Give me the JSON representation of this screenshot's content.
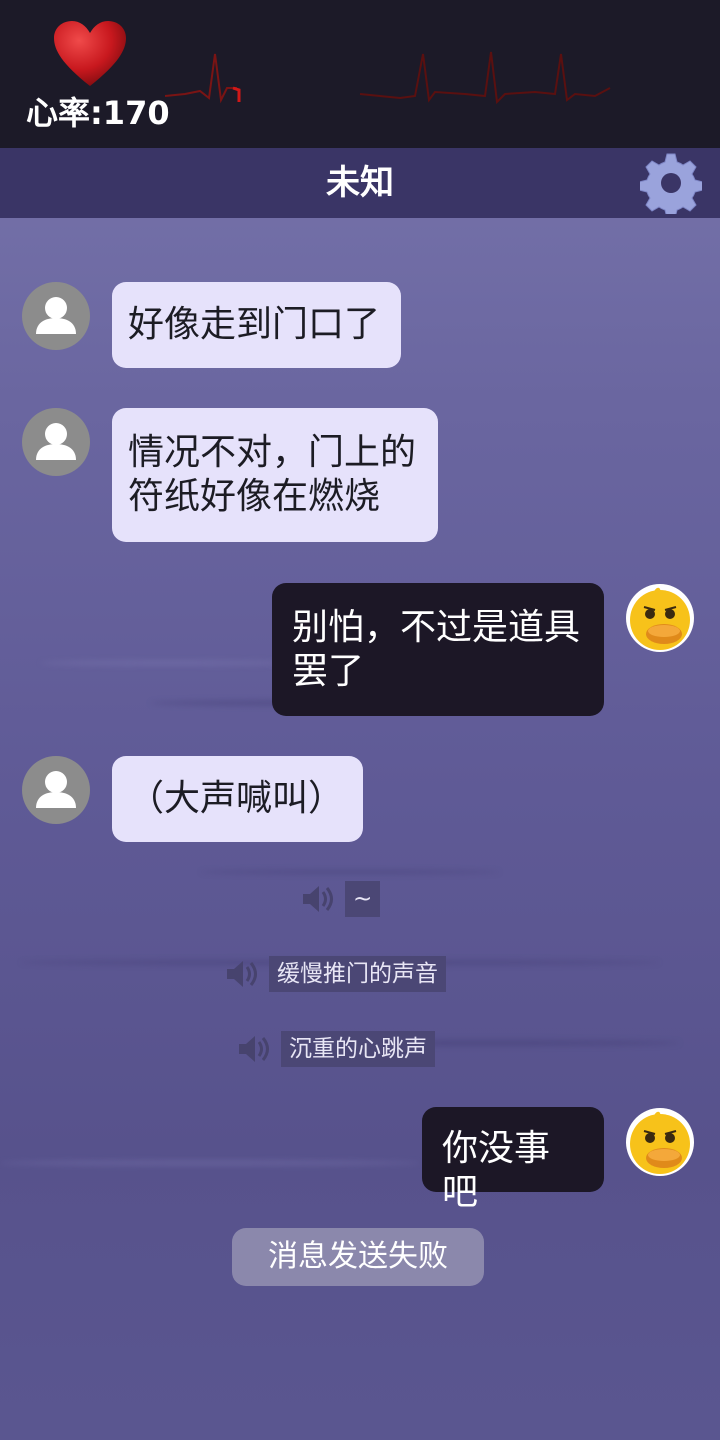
{
  "status": {
    "heart_rate_text": "心率:170"
  },
  "header": {
    "title": "未知"
  },
  "icons": {
    "heart": "heart-icon",
    "settings": "gear-icon",
    "speaker": "speaker-icon",
    "avatar_other": "user-avatar-icon",
    "avatar_me": "duck-avatar-icon"
  },
  "colors": {
    "heart": "#c8181e",
    "ecg_line": "#7a1414",
    "bubble_other": "#e6e2fb",
    "bubble_me": "#1c1726",
    "title_bar": "#3a3566"
  },
  "messages": [
    {
      "sender": "other",
      "lines": [
        "好像走到门口了"
      ]
    },
    {
      "sender": "other",
      "lines": [
        "情况不对，门上的",
        "符纸好像在燃烧"
      ]
    },
    {
      "sender": "me",
      "lines": [
        "别怕，不过是道具",
        "罢了"
      ]
    },
    {
      "sender": "other",
      "lines": [
        "（大声喊叫）"
      ]
    },
    {
      "sender": "me",
      "lines": [
        "你没事吧"
      ]
    }
  ],
  "sound_cues": [
    "~",
    "缓慢推门的声音",
    "沉重的心跳声"
  ],
  "system_notice": "消息发送失败"
}
